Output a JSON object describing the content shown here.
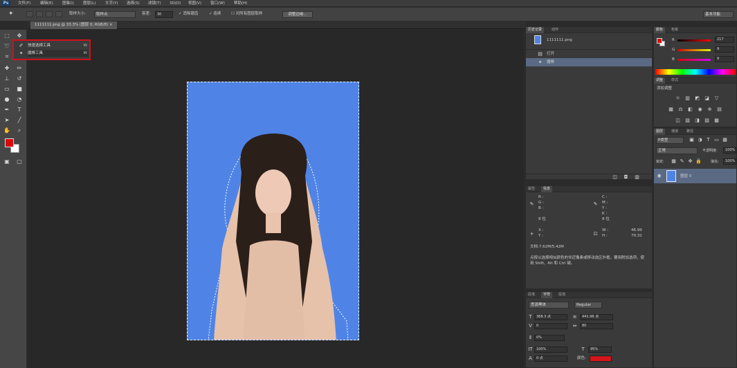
{
  "menubar": {
    "logo": "Ps",
    "items": [
      "文件(F)",
      "编辑(E)",
      "图像(I)",
      "图层(L)",
      "文字(Y)",
      "选择(S)",
      "滤镜(T)",
      "3D(D)",
      "视图(V)",
      "窗口(W)",
      "帮助(H)"
    ],
    "workspace": "基本功能"
  },
  "options": {
    "brush_size_label": "取样大小:",
    "brush_size_value": "取样点",
    "tolerance_label": "容差:",
    "tolerance_value": "30",
    "anti_alias": "消除锯齿",
    "contiguous": "连续",
    "sample_all": "对所有图层取样",
    "refine_edge": "调整边缘..."
  },
  "document": {
    "tab_title": "1111111.png @ 33.3% (图层 0, RGB/8)",
    "close": "×"
  },
  "flyout": {
    "items": [
      {
        "label": "快速选择工具",
        "key": "W"
      },
      {
        "label": "魔棒工具",
        "key": "W"
      }
    ]
  },
  "history": {
    "tabs": [
      "历史记录",
      "动作"
    ],
    "snapshot": "1111111.png",
    "entries": [
      "打开",
      "魔棒"
    ]
  },
  "color": {
    "tabs": [
      "颜色",
      "色板"
    ],
    "r_label": "R",
    "r_value": "217",
    "g_label": "G",
    "g_value": "9",
    "b_label": "B",
    "b_value": "9",
    "fg": "#d9090b",
    "bg": "#ffffff"
  },
  "adjustments": {
    "tabs": [
      "调整",
      "样式"
    ],
    "add_label": "添加调整"
  },
  "layers": {
    "tabs": [
      "图层",
      "通道",
      "路径"
    ],
    "kind": "P类型",
    "blend": "正常",
    "opacity_label": "不透明度:",
    "opacity_value": "100%",
    "lock_label": "锁定:",
    "fill_label": "填充:",
    "fill_value": "100%",
    "layer_name": "图层 0"
  },
  "info": {
    "tabs": [
      "属性",
      "信息"
    ],
    "rgb": [
      "R :",
      "G :",
      "B :"
    ],
    "bit": "8 位",
    "cmyk": [
      "C :",
      "M :",
      "Y :",
      "K :"
    ],
    "bit2": "8 位",
    "xy": [
      "X :",
      "Y :"
    ],
    "wh_labels": [
      "W :",
      "H :"
    ],
    "w": "46.99",
    "h": "79.32",
    "doc": "文档:7.62M/5.42M",
    "hint": "点按以选择相似颜色的邻近像素或移动选区外框。要用附加选项，使用 Shift、Alt 和 Ctrl 键。"
  },
  "character": {
    "tabs": [
      "段落",
      "字符",
      "段落"
    ],
    "font": "思源黑体",
    "style": "Regular",
    "size": "368.3 点",
    "leading": "441.96 点",
    "kerning": "0",
    "tracking": "80",
    "scale_h": "0%",
    "vscale": "100%",
    "hscale": "95%",
    "baseline": "0 点",
    "color_label": "颜色:",
    "color": "#d4151b"
  }
}
